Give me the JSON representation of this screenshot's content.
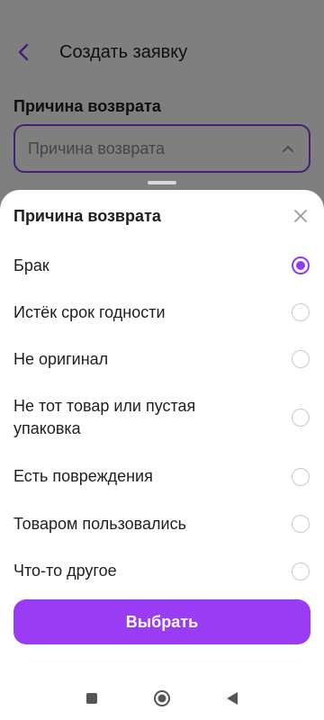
{
  "header": {
    "title": "Создать заявку",
    "back_icon": "chevron-left-icon"
  },
  "form": {
    "section_label": "Причина возврата",
    "select_placeholder": "Причина возврата",
    "select_icon": "chevron-up-icon"
  },
  "sheet": {
    "title": "Причина возврата",
    "close_icon": "close-icon",
    "options": [
      {
        "label": "Брак",
        "selected": true
      },
      {
        "label": "Истёк срок годности",
        "selected": false
      },
      {
        "label": "Не оригинал",
        "selected": false
      },
      {
        "label": "Не тот товар или пустая упаковка",
        "selected": false
      },
      {
        "label": "Есть повреждения",
        "selected": false
      },
      {
        "label": "Товаром пользовались",
        "selected": false
      },
      {
        "label": "Что-то другое",
        "selected": false
      }
    ],
    "confirm_label": "Выбрать"
  },
  "navigation_bar": {
    "icons": [
      "recents-icon",
      "home-icon",
      "back-triangle-icon"
    ]
  },
  "colors": {
    "accent": "#8e3df3",
    "button": "#9b3cf5",
    "scrim": "rgba(0,0,0,0.5)"
  }
}
